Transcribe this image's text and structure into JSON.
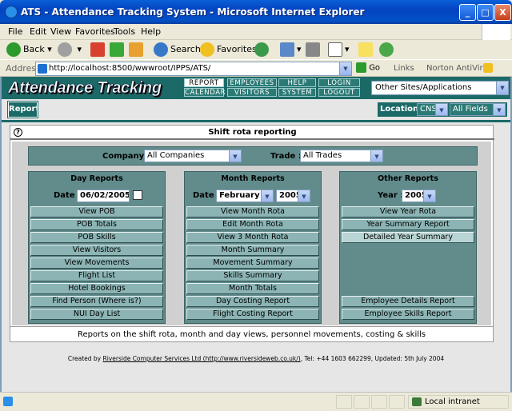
{
  "window": {
    "title": "ATS - Attendance Tracking System - Microsoft Internet Explorer",
    "buttons": [
      "_",
      "□",
      "X"
    ]
  },
  "menu": [
    "File",
    "Edit",
    "View",
    "Favorites",
    "Tools",
    "Help"
  ],
  "toolbar": {
    "back": "Back",
    "search": "Search",
    "favorites": "Favorites"
  },
  "address": {
    "label": "Address",
    "url": "http://localhost:8500/wwwroot/IPPS/ATS/",
    "go": "Go",
    "links": "Links",
    "norton": "Norton AntiVirus"
  },
  "app": {
    "logo": "Attendance Tracking",
    "nav": [
      [
        "REPORT",
        "EMPLOYEES",
        "HELP",
        "LOGIN"
      ],
      [
        "CALENDAR",
        "VISITORS",
        "SYSTEM",
        "LOGOUT"
      ]
    ],
    "other_sites": "Other Sites/Applications",
    "tab": "Report",
    "location_label": "Location :",
    "location_value": "CNS",
    "fields_value": "All Fields"
  },
  "panel": {
    "title": "Shift rota reporting",
    "company_label": "Company :",
    "company_value": "All Companies",
    "trade_label": "Trade :",
    "trade_value": "All Trades",
    "day": {
      "title": "Day Reports",
      "date_label": "Date :",
      "date_value": "06/02/2005",
      "buttons": [
        "View POB",
        "POB Totals",
        "POB Skills",
        "View Visitors",
        "View Movements",
        "Flight List",
        "Hotel Bookings",
        "Find Person (Where is?)",
        "NUI Day List"
      ]
    },
    "month": {
      "title": "Month Reports",
      "date_label": "Date :",
      "month_value": "February",
      "year_value": "2005",
      "buttons": [
        "View Month Rota",
        "Edit Month Rota",
        "View 3 Month Rota",
        "Month Summary",
        "Movement Summary",
        "Skills Summary",
        "Month Totals",
        "Day Costing Report",
        "Flight Costing Report"
      ]
    },
    "other": {
      "title": "Other Reports",
      "year_label": "Year :",
      "year_value": "2005",
      "top_buttons": [
        "View Year Rota",
        "Year Summary Report",
        "Detailed Year Summary"
      ],
      "bottom_buttons": [
        "Employee Details Report",
        "Employee Skills Report"
      ]
    },
    "description": "Reports on the shift rota, month and day views, personnel movements, costing & skills"
  },
  "credits": {
    "prefix": "Created by ",
    "link": "Riverside Computer Services Ltd (http://www.riversideweb.co.uk/)",
    "suffix": ", Tel: +44 1603 662299, Updated: 5th July 2004"
  },
  "status": {
    "zone": "Local intranet"
  },
  "colors": {
    "teal": "#1c6a68",
    "panel_teal": "#628c8c",
    "button": "#8cb4b4"
  }
}
